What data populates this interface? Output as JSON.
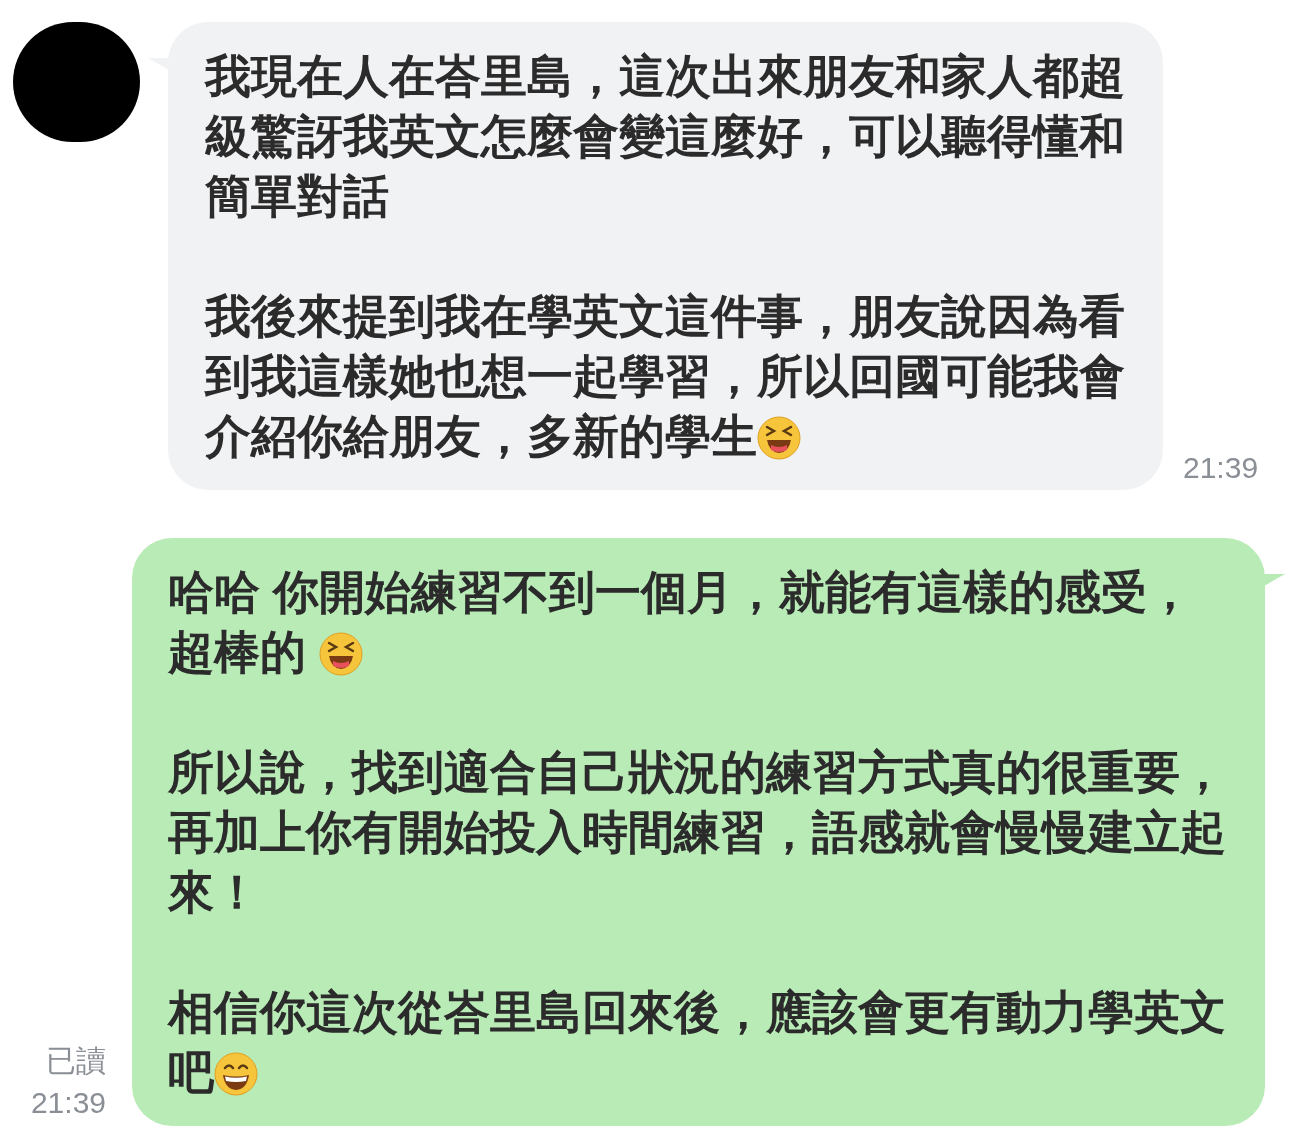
{
  "messages": [
    {
      "kind": "incoming",
      "time": "21:39",
      "paragraphs": [
        {
          "kind": "plain",
          "text": "我現在人在峇里島，這次出來朋友和家人都超級驚訝我英文怎麼會變這麼好，可以聽得懂和簡單對話"
        },
        {
          "kind": "squint",
          "text": "我後來提到我在學英文這件事，朋友說因為看到我這樣她也想一起學習，所以回國可能我會介紹你給朋友，多新的學生"
        }
      ]
    },
    {
      "kind": "outgoing",
      "time": "21:39",
      "read_label": "已讀",
      "paragraphs": [
        {
          "kind": "squint",
          "text": "哈哈 你開始練習不到一個月，就能有這樣的感受，超棒的 "
        },
        {
          "kind": "plain",
          "text": "所以說，找到適合自己狀況的練習方式真的很重要，再加上你有開始投入時間練習，語感就會慢慢建立起來！"
        },
        {
          "kind": "grin",
          "text": "相信你這次從峇里島回來後，應該會更有動力學英文吧"
        }
      ]
    }
  ]
}
